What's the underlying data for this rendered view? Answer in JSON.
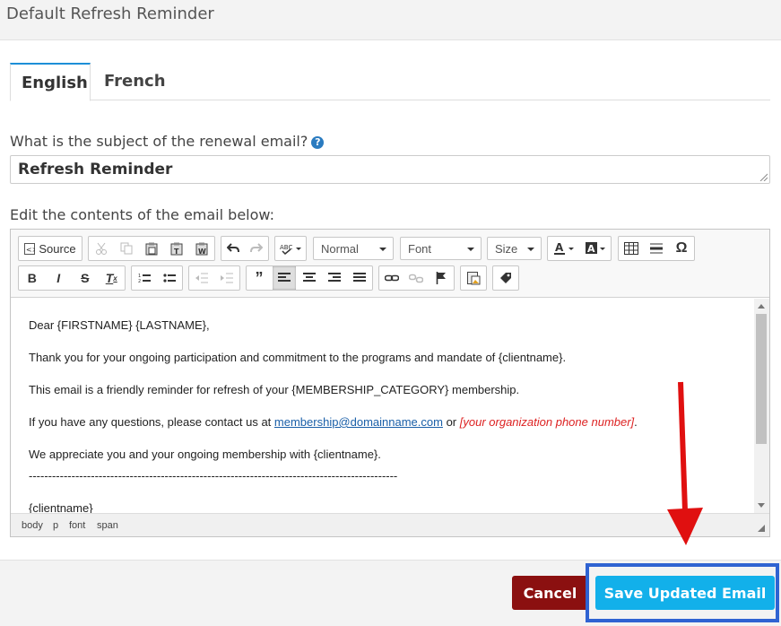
{
  "modal": {
    "title": "Default Refresh Reminder"
  },
  "tabs": [
    {
      "label": "English",
      "active": true
    },
    {
      "label": "French",
      "active": false
    }
  ],
  "subject": {
    "label": "What is the subject of the renewal email?",
    "help_icon": "question-circle-icon",
    "value": "Refresh Reminder"
  },
  "editor": {
    "label": "Edit the contents of the email below:",
    "toolbar": {
      "source_label": "Source",
      "format_label": "Normal",
      "font_label": "Font",
      "size_label": "Size",
      "special_char": "Ω"
    },
    "content": {
      "line1": "Dear {FIRSTNAME} {LASTNAME},",
      "line2": "Thank you for your ongoing participation and commitment to the programs and mandate of {clientname}.",
      "line3": "This email is a friendly reminder for refresh of your {MEMBERSHIP_CATEGORY} membership.",
      "line4_prefix": "If you have any questions, please contact us at ",
      "line4_link": "membership@domainname.com",
      "line4_mid": " or ",
      "line4_red": "[your organization phone number]",
      "line4_end": ".",
      "line5": "We appreciate you and your ongoing membership with {clientname}.",
      "divider": "-----------------------------------------------------------------------------------------------",
      "line6": "{clientname}"
    },
    "path": [
      "body",
      "p",
      "font",
      "span"
    ]
  },
  "footer": {
    "cancel_label": "Cancel",
    "save_label": "Save Updated Email"
  },
  "colors": {
    "tab_accent": "#1d8fd7",
    "cancel": "#8b1010",
    "save": "#12b0ea",
    "highlight": "#2f63d2",
    "arrow": "#e01010"
  }
}
